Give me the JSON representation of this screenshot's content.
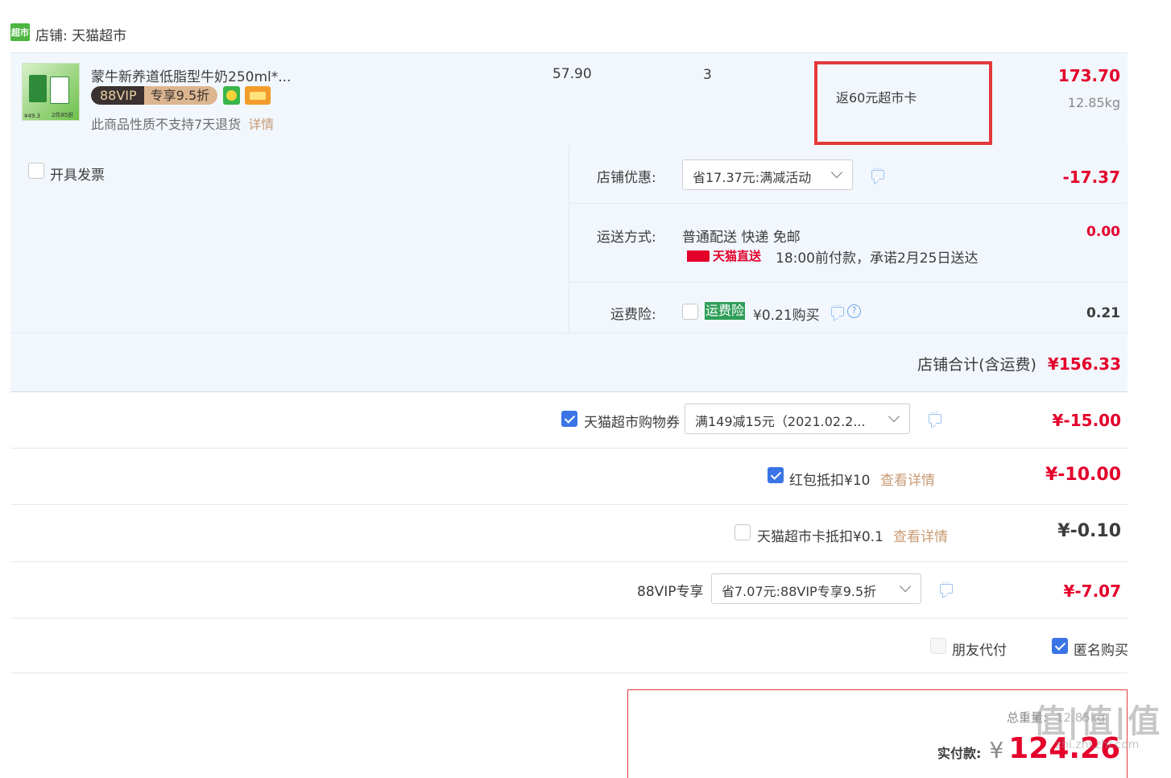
{
  "shop": {
    "logo_text": "超市",
    "label": "店铺: 天猫超市"
  },
  "item": {
    "name": "蒙牛新养道低脂型牛奶250ml*...",
    "vip_badge": "88VIP",
    "vip_discount": "专享9.5折",
    "return_notice": "此商品性质不支持7天退货",
    "detail_link": "详情",
    "unit_price": "57.90",
    "quantity": "3",
    "promo_note": "返60元超市卡",
    "subtotal": "173.70",
    "weight": "12.85kg",
    "thumb_prices": [
      "¥49.3",
      "2件85折"
    ]
  },
  "invoice": {
    "label": "开具发票"
  },
  "store_discount": {
    "label": "店铺优惠:",
    "selected": "省17.37元:满减活动",
    "amount": "-17.37"
  },
  "shipping": {
    "label": "运送方式:",
    "method": "普通配送 快递 免邮",
    "badge": "天猫直送",
    "promise": "18:00前付款，承诺2月25日送达",
    "amount": "0.00"
  },
  "insurance": {
    "label": "运费险:",
    "tag": "运费险",
    "price_text": "¥0.21购买",
    "amount": "0.21"
  },
  "store_total": {
    "label": "店铺合计(含运费)",
    "amount": "¥156.33"
  },
  "coupon": {
    "label": "天猫超市购物券",
    "selected": "满149减15元（2021.02.2...",
    "amount": "¥-15.00"
  },
  "redpacket": {
    "label": "红包抵扣¥10",
    "link": "查看详情",
    "amount": "¥-10.00"
  },
  "market_card": {
    "label": "天猫超市卡抵扣¥0.1",
    "link": "查看详情",
    "amount": "¥-0.10"
  },
  "vip88": {
    "label": "88VIP专享",
    "selected": "省7.07元:88VIP专享9.5折",
    "amount": "¥-7.07"
  },
  "options": {
    "friend_pay": "朋友代付",
    "anonymous": "匿名购买"
  },
  "summary": {
    "weight_label": "总重量:",
    "weight_value": "12.85kg",
    "pay_label": "实付款:",
    "currency": "¥",
    "pay_amount": "124.26"
  },
  "watermark": {
    "main": "值|值|值",
    "sub": "zhi.zhi.zhi.com"
  },
  "colors": {
    "accent_red": "#e4002b",
    "check_blue": "#3a74e6",
    "row_bg": "#f2f7fd",
    "tmall_green": "#4cb640",
    "link_tan": "#c89a72",
    "highlight_box": "#e4393c"
  }
}
